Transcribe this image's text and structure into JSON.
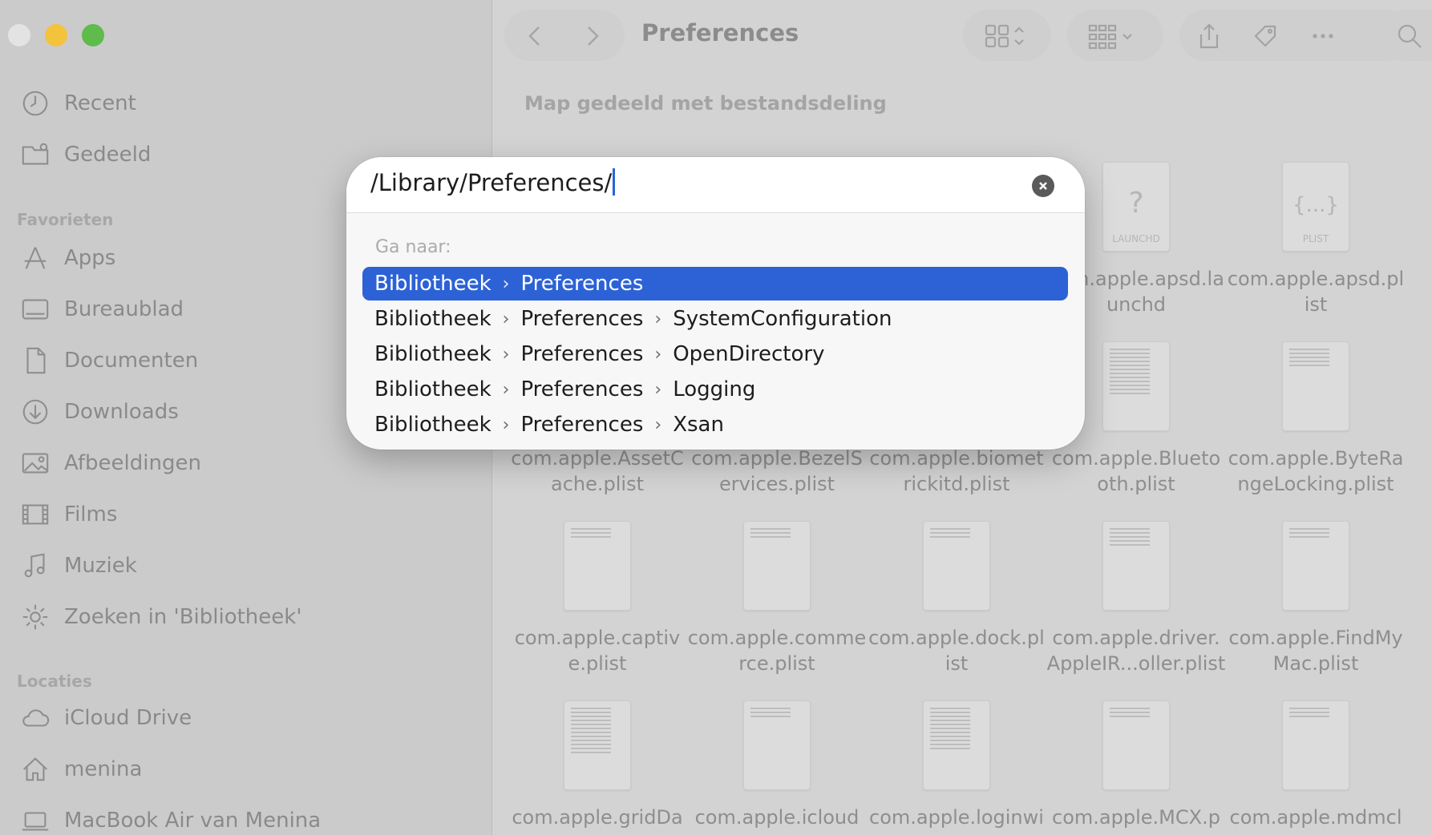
{
  "window": {
    "title": "Preferences"
  },
  "sidebar": {
    "sections": {
      "favorites": "Favorieten",
      "locations": "Locaties"
    },
    "top_items": [
      {
        "label": "Recent",
        "icon": "clock-icon"
      },
      {
        "label": "Gedeeld",
        "icon": "shared-folder-icon"
      }
    ],
    "favorites": [
      {
        "label": "Apps",
        "icon": "apps-icon"
      },
      {
        "label": "Bureaublad",
        "icon": "desktop-icon"
      },
      {
        "label": "Documenten",
        "icon": "document-icon"
      },
      {
        "label": "Downloads",
        "icon": "download-icon"
      },
      {
        "label": "Afbeeldingen",
        "icon": "photo-icon"
      },
      {
        "label": "Films",
        "icon": "film-icon"
      },
      {
        "label": "Muziek",
        "icon": "music-icon"
      },
      {
        "label": "Zoeken in 'Bibliotheek'",
        "icon": "gear-icon"
      }
    ],
    "locations": [
      {
        "label": "iCloud Drive",
        "icon": "cloud-icon"
      },
      {
        "label": "menina",
        "icon": "home-icon"
      },
      {
        "label": "MacBook Air van Menina",
        "icon": "laptop-icon"
      }
    ]
  },
  "content": {
    "section_header": "Map gedeeld met bestandsdeling",
    "files": [
      {
        "name": "com.apple.apsd.launchd",
        "badge": "?",
        "badge_label": "LAUNCHD"
      },
      {
        "name": "com.apple.apsd.plist",
        "badge": "{...}",
        "badge_label": "PLIST"
      },
      {
        "name": "com.apple.AssetCache.plist"
      },
      {
        "name": "com.apple.BezelServices.plist"
      },
      {
        "name": "com.apple.biometrickitd.plist"
      },
      {
        "name": "com.apple.Bluetooth.plist"
      },
      {
        "name": "com.apple.ByteRangeLocking.plist"
      },
      {
        "name": "com.apple.captive.plist"
      },
      {
        "name": "com.apple.commerce.plist"
      },
      {
        "name": "com.apple.dock.plist"
      },
      {
        "name": "com.apple.driver.AppleIR...oller.plist"
      },
      {
        "name": "com.apple.FindMyMac.plist"
      },
      {
        "name": "com.apple.gridDa"
      },
      {
        "name": "com.apple.icloud"
      },
      {
        "name": "com.apple.loginwi"
      },
      {
        "name": "com.apple.MCX.p"
      },
      {
        "name": "com.apple.mdmcl"
      }
    ]
  },
  "goto_dialog": {
    "path_value": "/Library/Preferences/",
    "goto_label": "Ga naar:",
    "suggestions": [
      [
        "Bibliotheek",
        "Preferences"
      ],
      [
        "Bibliotheek",
        "Preferences",
        "SystemConfiguration"
      ],
      [
        "Bibliotheek",
        "Preferences",
        "OpenDirectory"
      ],
      [
        "Bibliotheek",
        "Preferences",
        "Logging"
      ],
      [
        "Bibliotheek",
        "Preferences",
        "Xsan"
      ]
    ],
    "selected_index": 0,
    "accent_color": "#2d62d6"
  },
  "colors": {
    "close": "#e3e3e3",
    "minimize": "#f3c33c",
    "maximize": "#5fbb4b"
  }
}
